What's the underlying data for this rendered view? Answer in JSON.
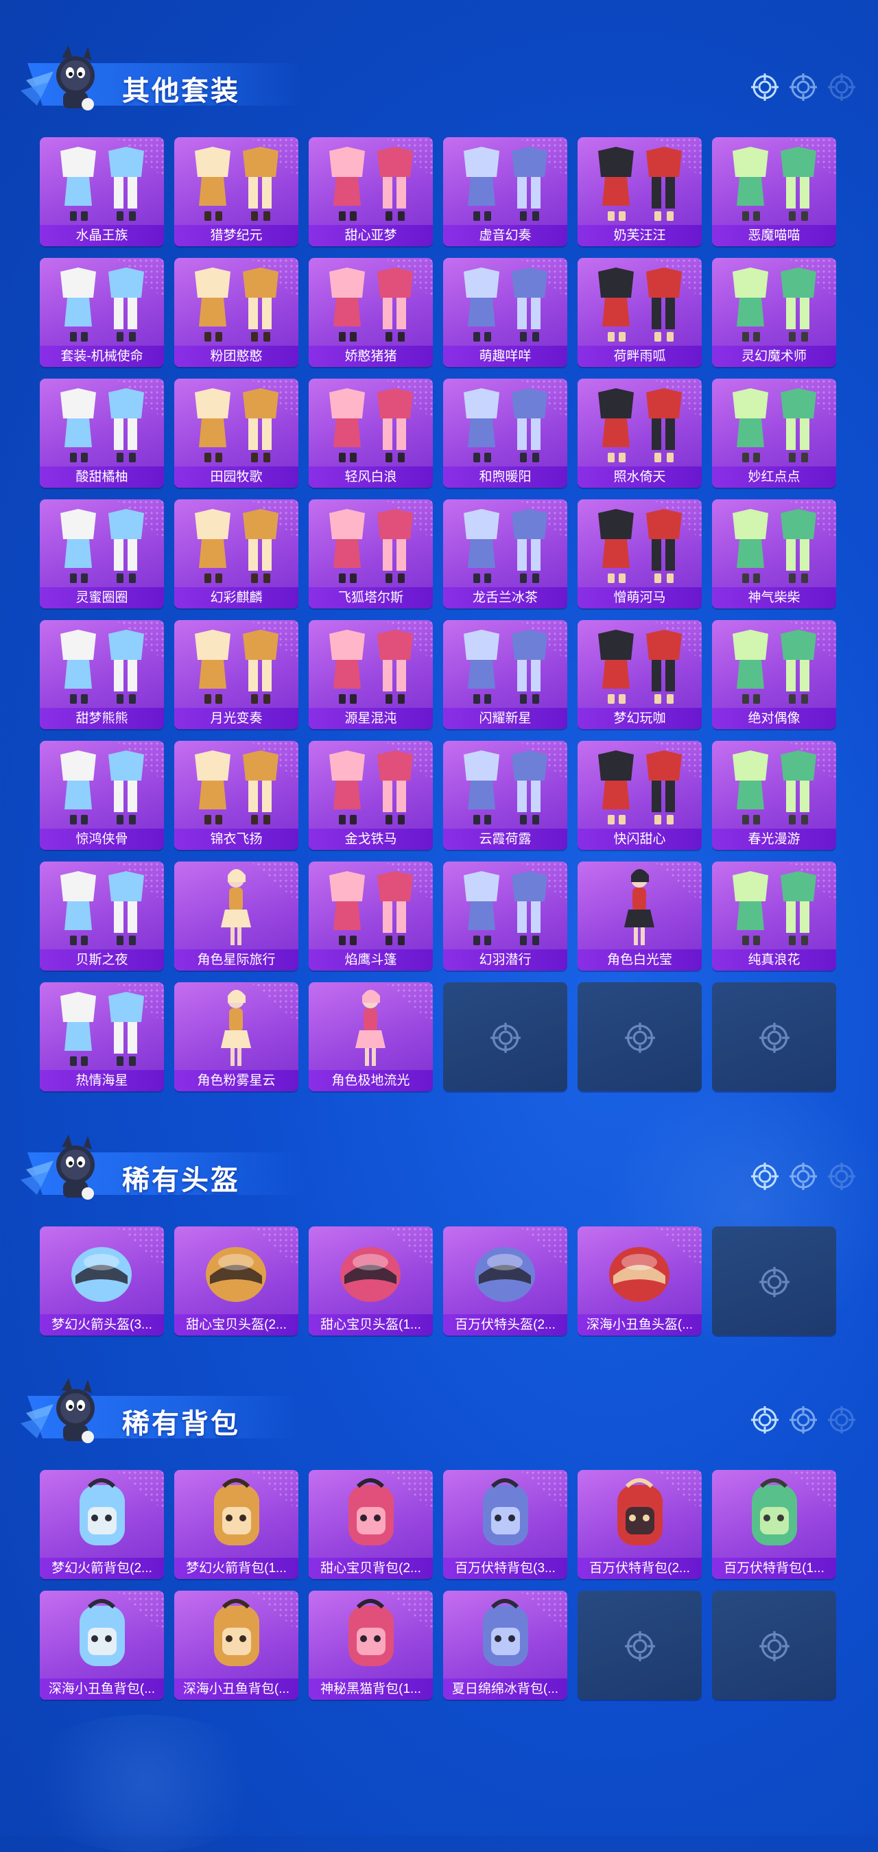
{
  "sections": [
    {
      "title": "其他套装",
      "items": [
        {
          "label": "水晶王族",
          "icon": "outfit-icon"
        },
        {
          "label": "猎梦纪元",
          "icon": "outfit-icon"
        },
        {
          "label": "甜心亚梦",
          "icon": "outfit-icon"
        },
        {
          "label": "虚音幻奏",
          "icon": "outfit-icon"
        },
        {
          "label": "奶芙汪汪",
          "icon": "outfit-icon"
        },
        {
          "label": "恶魔喵喵",
          "icon": "outfit-icon"
        },
        {
          "label": "套装-机械使命",
          "icon": "outfit-icon"
        },
        {
          "label": "粉团憨憨",
          "icon": "outfit-icon"
        },
        {
          "label": "娇憨猪猪",
          "icon": "outfit-icon"
        },
        {
          "label": "萌趣咩咩",
          "icon": "outfit-icon"
        },
        {
          "label": "荷畔雨呱",
          "icon": "outfit-icon"
        },
        {
          "label": "灵幻魔术师",
          "icon": "outfit-icon"
        },
        {
          "label": "酸甜橘柚",
          "icon": "outfit-icon"
        },
        {
          "label": "田园牧歌",
          "icon": "outfit-icon"
        },
        {
          "label": "轻风白浪",
          "icon": "outfit-icon"
        },
        {
          "label": "和煦暖阳",
          "icon": "outfit-icon"
        },
        {
          "label": "照水倚天",
          "icon": "outfit-icon"
        },
        {
          "label": "妙红点点",
          "icon": "outfit-icon"
        },
        {
          "label": "灵蜜圈圈",
          "icon": "outfit-icon"
        },
        {
          "label": "幻彩麒麟",
          "icon": "outfit-icon"
        },
        {
          "label": "飞狐塔尔斯",
          "icon": "outfit-icon"
        },
        {
          "label": "龙舌兰冰茶",
          "icon": "outfit-icon"
        },
        {
          "label": "憎萌河马",
          "icon": "outfit-icon"
        },
        {
          "label": "神气柴柴",
          "icon": "outfit-icon"
        },
        {
          "label": "甜梦熊熊",
          "icon": "outfit-icon"
        },
        {
          "label": "月光变奏",
          "icon": "outfit-icon"
        },
        {
          "label": "源星混沌",
          "icon": "outfit-icon"
        },
        {
          "label": "闪耀新星",
          "icon": "outfit-icon"
        },
        {
          "label": "梦幻玩咖",
          "icon": "outfit-icon"
        },
        {
          "label": "绝对偶像",
          "icon": "outfit-icon"
        },
        {
          "label": "惊鸿侠骨",
          "icon": "outfit-icon"
        },
        {
          "label": "锦衣飞扬",
          "icon": "outfit-icon"
        },
        {
          "label": "金戈铁马",
          "icon": "outfit-icon"
        },
        {
          "label": "云霞荷露",
          "icon": "outfit-icon"
        },
        {
          "label": "快闪甜心",
          "icon": "outfit-icon"
        },
        {
          "label": "春光漫游",
          "icon": "outfit-icon"
        },
        {
          "label": "贝斯之夜",
          "icon": "outfit-icon"
        },
        {
          "label": "角色星际旅行",
          "icon": "character-icon"
        },
        {
          "label": "焰鹰斗篷",
          "icon": "outfit-icon"
        },
        {
          "label": "幻羽潜行",
          "icon": "outfit-icon"
        },
        {
          "label": "角色白光莹",
          "icon": "character-icon"
        },
        {
          "label": "纯真浪花",
          "icon": "outfit-icon"
        },
        {
          "label": "热情海星",
          "icon": "outfit-icon"
        },
        {
          "label": "角色粉雾星云",
          "icon": "character-icon"
        },
        {
          "label": "角色极地流光",
          "icon": "character-icon"
        }
      ],
      "empty_slots": 3
    },
    {
      "title": "稀有头盔",
      "items": [
        {
          "label": "梦幻火箭头盔(3...",
          "icon": "helmet-icon"
        },
        {
          "label": "甜心宝贝头盔(2...",
          "icon": "helmet-icon"
        },
        {
          "label": "甜心宝贝头盔(1...",
          "icon": "helmet-icon"
        },
        {
          "label": "百万伏特头盔(2...",
          "icon": "helmet-icon"
        },
        {
          "label": "深海小丑鱼头盔(...",
          "icon": "helmet-icon"
        }
      ],
      "empty_slots": 1
    },
    {
      "title": "稀有背包",
      "items": [
        {
          "label": "梦幻火箭背包(2...",
          "icon": "backpack-icon"
        },
        {
          "label": "梦幻火箭背包(1...",
          "icon": "backpack-icon"
        },
        {
          "label": "甜心宝贝背包(2...",
          "icon": "backpack-icon"
        },
        {
          "label": "百万伏特背包(3...",
          "icon": "backpack-icon"
        },
        {
          "label": "百万伏特背包(2...",
          "icon": "backpack-icon"
        },
        {
          "label": "百万伏特背包(1...",
          "icon": "backpack-icon"
        },
        {
          "label": "深海小丑鱼背包(...",
          "icon": "backpack-icon"
        },
        {
          "label": "深海小丑鱼背包(...",
          "icon": "backpack-icon"
        },
        {
          "label": "神秘黑猫背包(1...",
          "icon": "backpack-icon"
        },
        {
          "label": "夏日绵绵冰背包(...",
          "icon": "backpack-icon"
        }
      ],
      "empty_slots": 2
    }
  ],
  "colors": {
    "background": "#0e4fd0",
    "tile_purple": "#a24fe2",
    "label_purple": "#7a22dc",
    "empty_tile": "#1f3d70",
    "accent_blue": "#2878ff"
  }
}
